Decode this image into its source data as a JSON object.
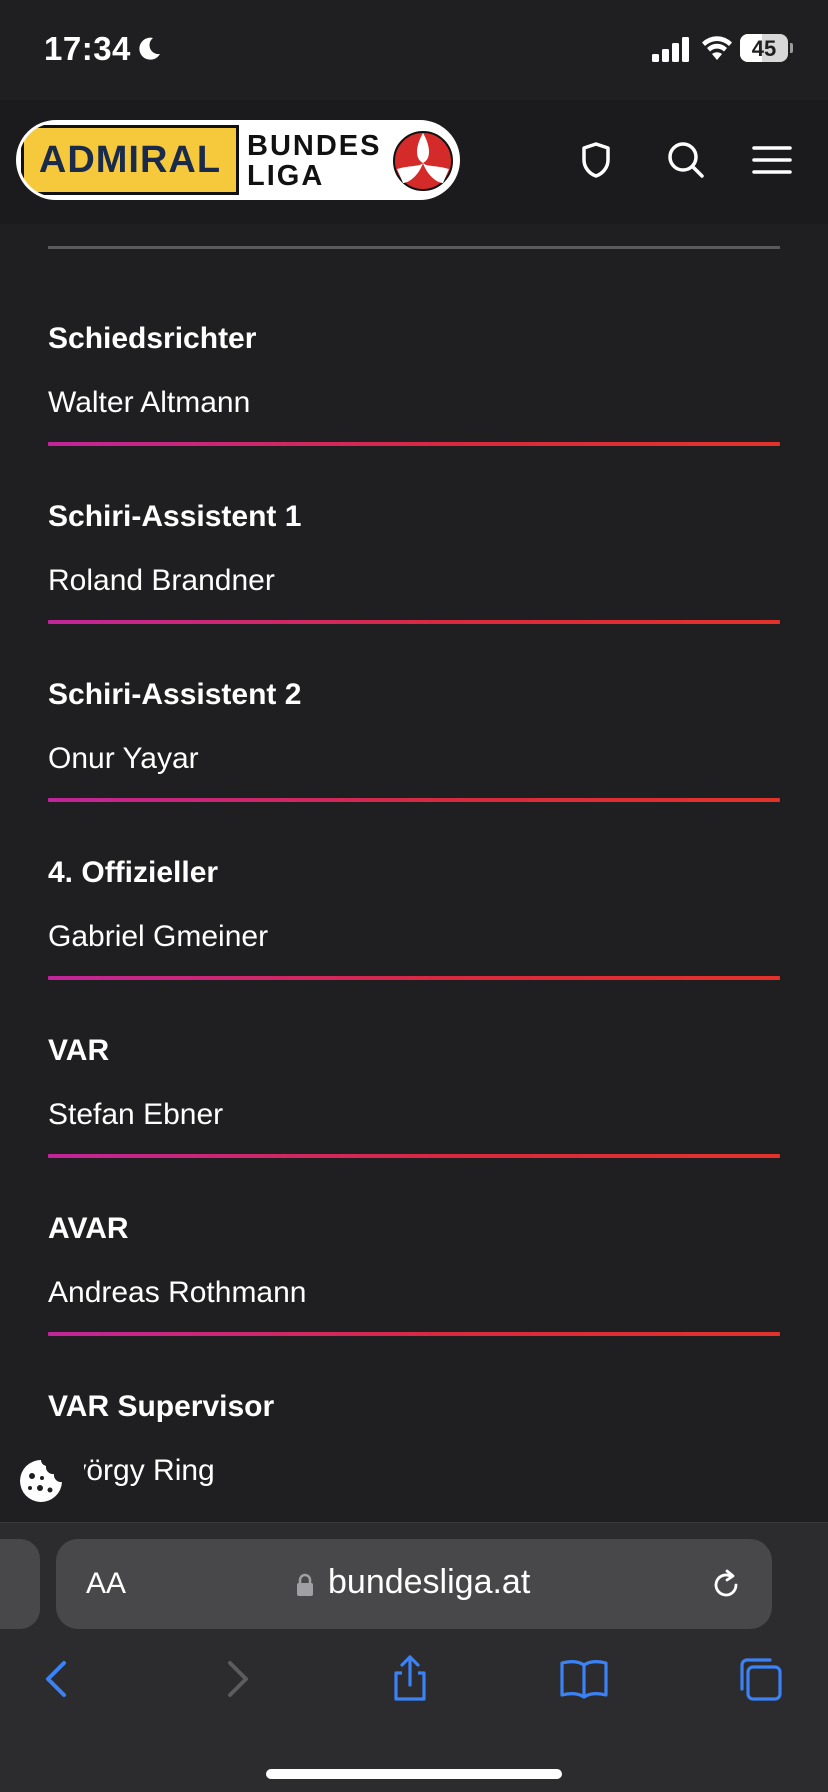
{
  "status_bar": {
    "time": "17:34",
    "battery_level": "45",
    "battery_percent": 45
  },
  "header": {
    "logo_sponsor": "ADMIRAL",
    "logo_text_line1": "BUNDES",
    "logo_text_line2": "LIGA",
    "icons": [
      "shield-icon",
      "search-icon",
      "menu-icon"
    ]
  },
  "officials": [
    {
      "role": "Schiedsrichter",
      "name": "Walter Altmann"
    },
    {
      "role": "Schiri-Assistent 1",
      "name": "Roland Brandner"
    },
    {
      "role": "Schiri-Assistent 2",
      "name": "Onur Yayar"
    },
    {
      "role": "4. Offizieller",
      "name": "Gabriel Gmeiner"
    },
    {
      "role": "VAR",
      "name": "Stefan Ebner"
    },
    {
      "role": "AVAR",
      "name": "Andreas Rothmann"
    },
    {
      "role": "VAR Supervisor",
      "name": "György Ring"
    }
  ],
  "browser": {
    "text_size_label": "AA",
    "url": "bundesliga.at",
    "toolbar_icons": [
      "back-icon",
      "forward-icon",
      "share-icon",
      "bookmarks-icon",
      "tabs-icon"
    ]
  },
  "colors": {
    "background": "#1f1f21",
    "divider_start": "#c2259b",
    "divider_end": "#e3322a",
    "accent_link": "#3b82f6",
    "logo_yellow": "#f5c93b"
  }
}
